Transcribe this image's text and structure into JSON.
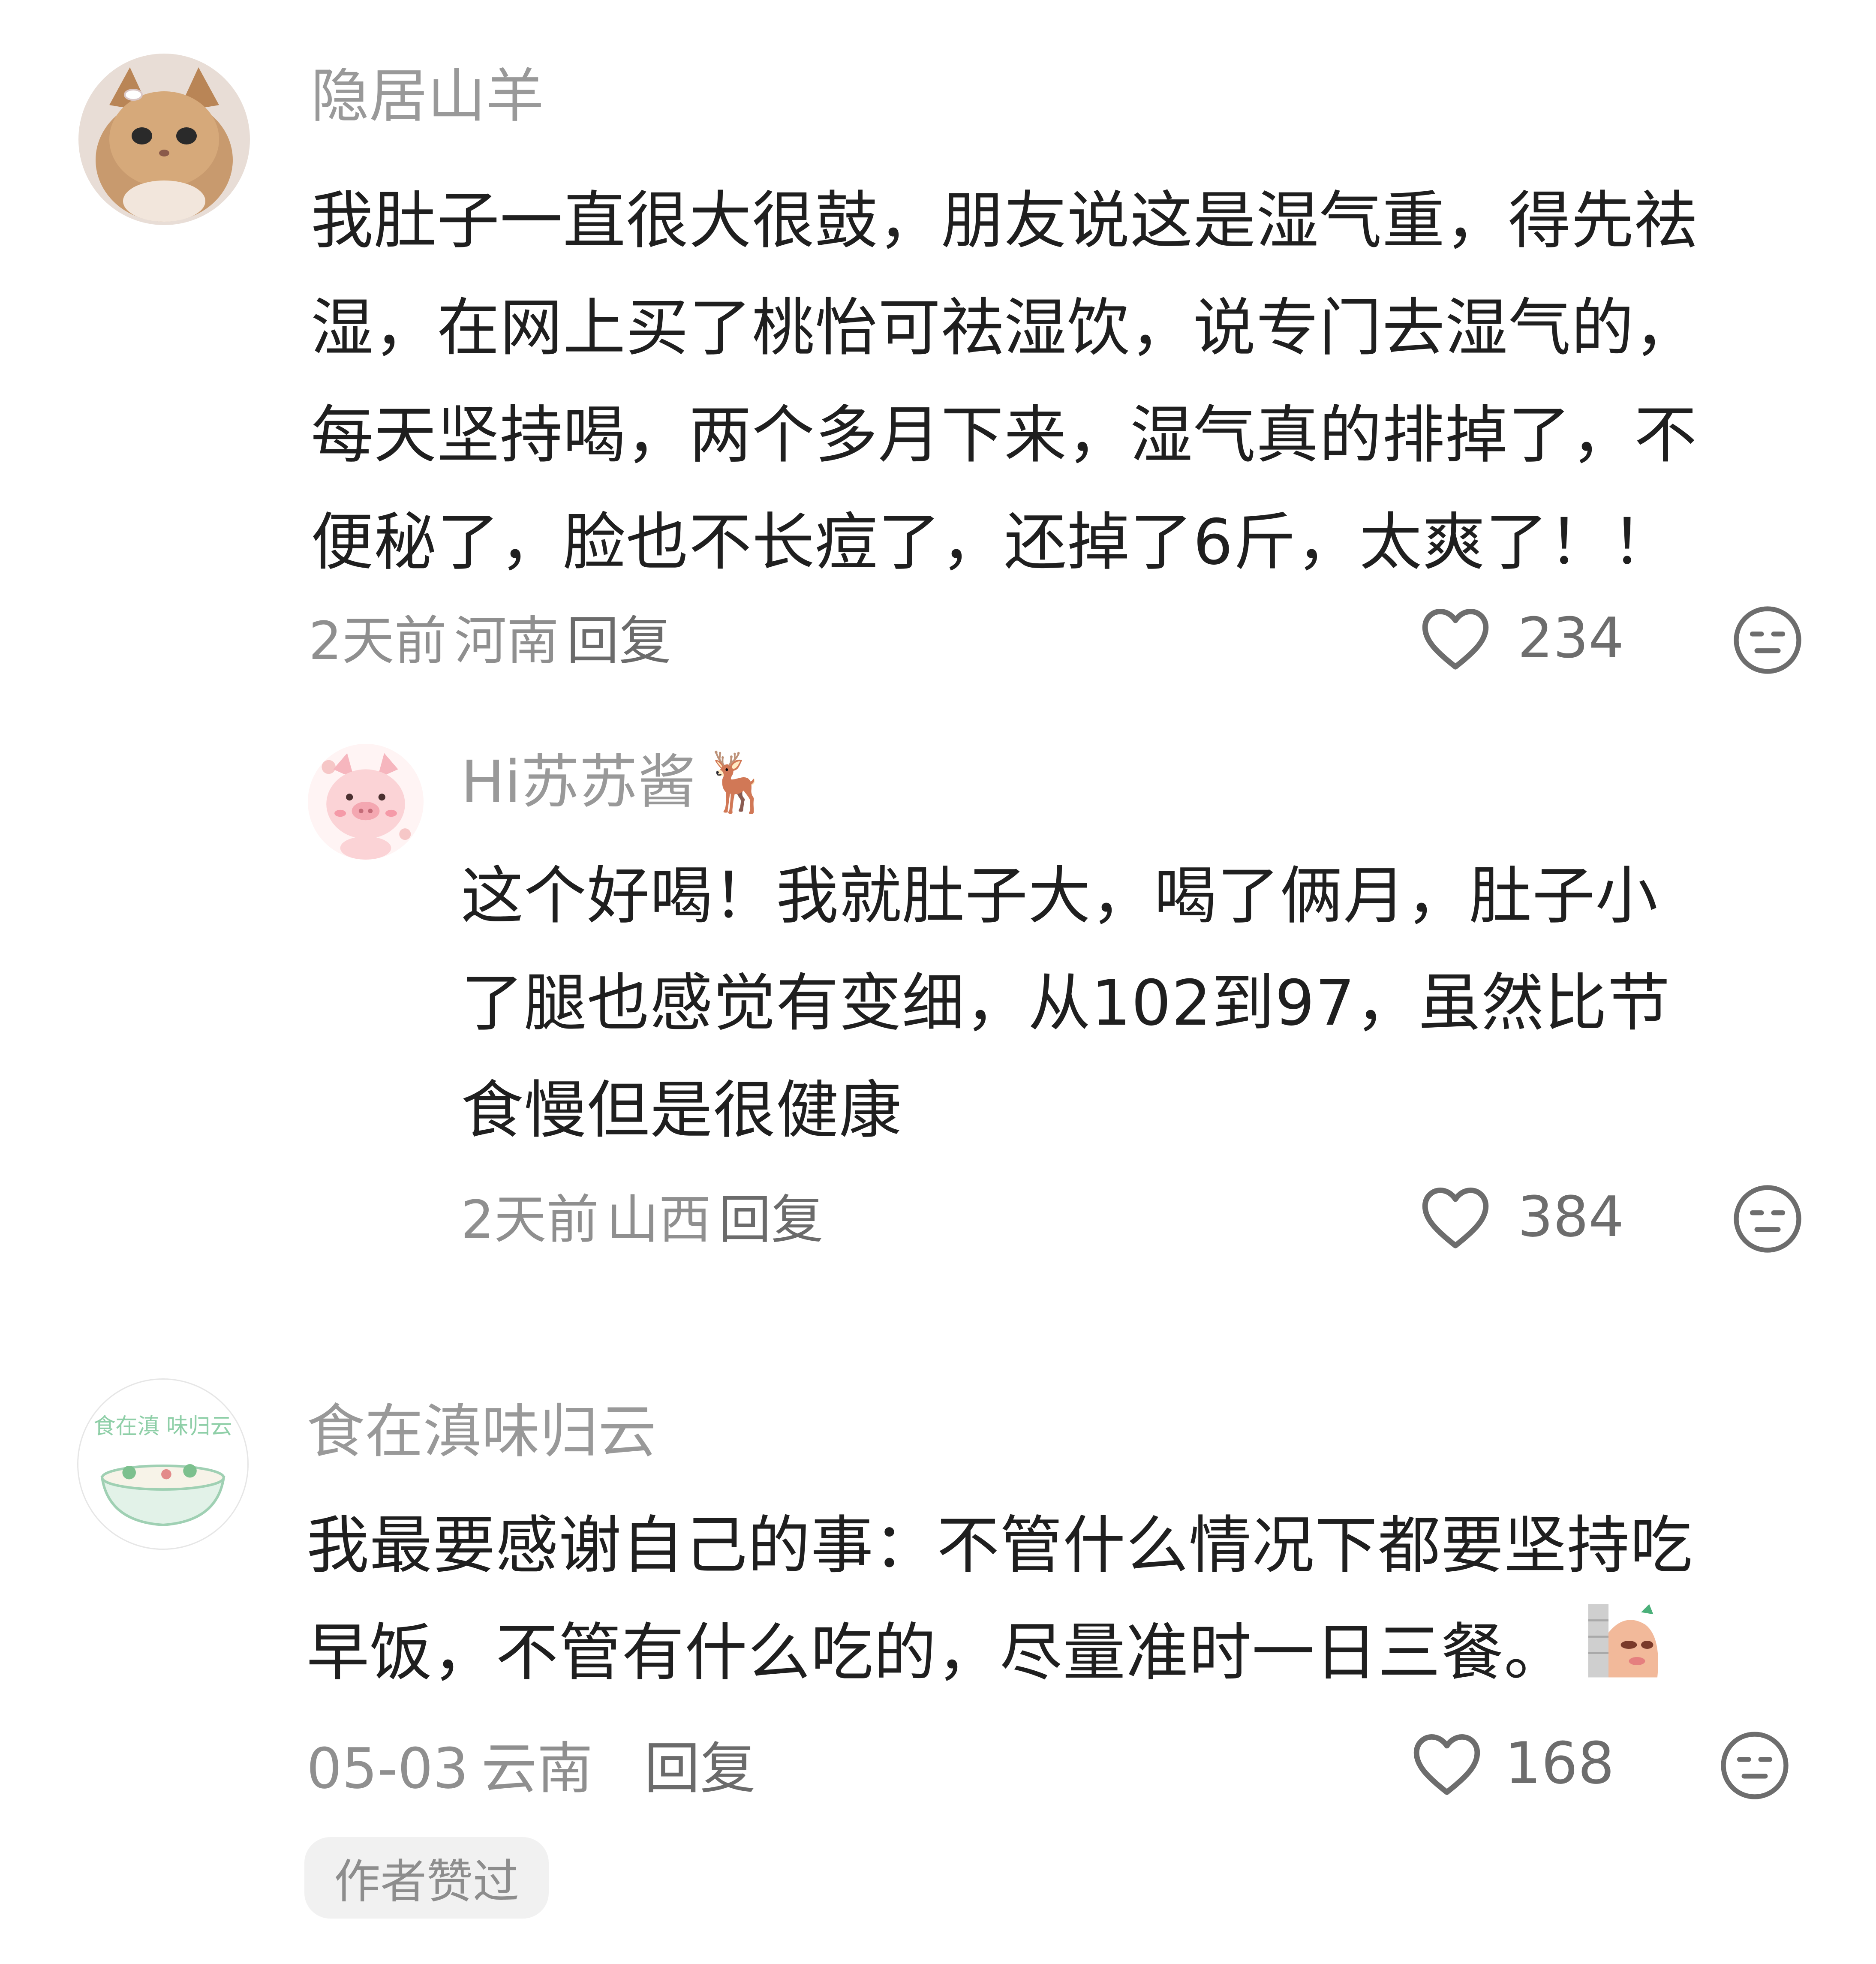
{
  "comments": [
    {
      "username": "隐居山羊",
      "avatar_icon": "kitten-avatar",
      "lines": [
        "我肚子一直很大很鼓，朋友说这是湿气重，得先祛",
        "湿，在网上买了桃怡可祛湿饮，说专门去湿气的，",
        "每天坚持喝，两个多月下来，湿气真的排掉了，不",
        "便秘了，脸也不长痘了，还掉了6斤，太爽了！！"
      ],
      "time": "2天前",
      "location": "河南",
      "reply_label": "回复",
      "likes": "234"
    },
    {
      "username": "Hi苏苏酱",
      "username_emoji": "🦌",
      "avatar_icon": "pig-avatar",
      "lines": [
        "这个好喝！我就肚子大，喝了俩月，肚子小",
        "了腿也感觉有变细，从102到97，虽然比节",
        "食慢但是很健康"
      ],
      "time": "2天前",
      "location": "山西",
      "reply_label": "回复",
      "likes": "384"
    },
    {
      "username": "食在滇味归云",
      "avatar_icon": "noodle-bowl-avatar",
      "avatar_text": "食在滇 味归云",
      "lines": [
        "我最要感谢自己的事：不管什么情况下都要坚持吃",
        "早饭，不管有什么吃的，尽量准时一日三餐。"
      ],
      "inline_sticker": "peeking-character-sticker",
      "time": "05-03",
      "location": "云南",
      "reply_label": "回复",
      "likes": "168",
      "author_badge": "作者赞过"
    }
  ],
  "colors": {
    "username": "#999999",
    "content": "#1f1f1f",
    "meta": "#8f8f8f",
    "icon": "#6d6d6d",
    "badge_bg": "#f1f1f1"
  }
}
